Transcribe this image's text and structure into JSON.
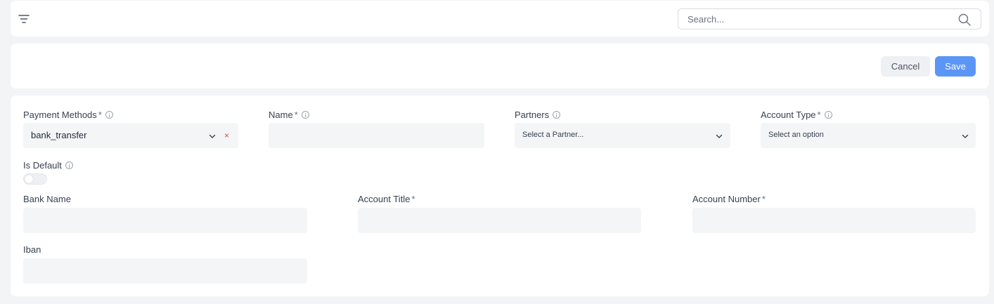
{
  "toolbar": {
    "search_placeholder": "Search...",
    "filter_icon": "filter-lines-icon",
    "search_icon": "magnifier-icon"
  },
  "actions": {
    "cancel_label": "Cancel",
    "save_label": "Save",
    "save_color": "#5b96f7"
  },
  "form": {
    "required_mark": "*",
    "payment_methods": {
      "label": "Payment Methods",
      "value": "bank_transfer",
      "clear": "×"
    },
    "name": {
      "label": "Name",
      "value": ""
    },
    "partners": {
      "label": "Partners",
      "placeholder": "Select a Partner..."
    },
    "account_type": {
      "label": "Account Type",
      "placeholder": "Select an option"
    },
    "is_default": {
      "label": "Is Default",
      "checked": false
    },
    "bank_name": {
      "label": "Bank Name",
      "value": ""
    },
    "account_title": {
      "label": "Account Title",
      "value": ""
    },
    "account_number": {
      "label": "Account Number",
      "value": ""
    },
    "iban": {
      "label": "Iban",
      "value": ""
    }
  }
}
